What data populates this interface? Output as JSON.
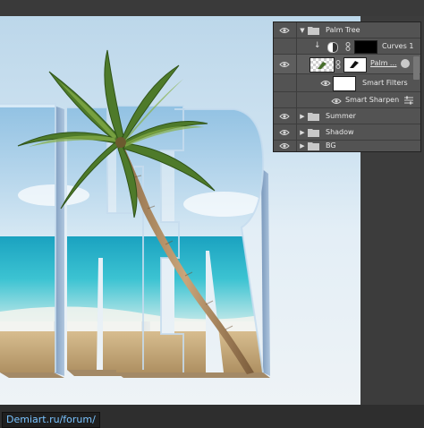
{
  "layers_panel": {
    "rows": [
      {
        "name": "Palm Tree",
        "kind": "group-open"
      },
      {
        "name": "Curves 1",
        "kind": "adjustment"
      },
      {
        "name": "Palm ...",
        "kind": "smart-object"
      },
      {
        "name": "Smart Filters",
        "kind": "smart-filters"
      },
      {
        "name": "Smart Sharpen",
        "kind": "filter"
      },
      {
        "name": "Summer",
        "kind": "group"
      },
      {
        "name": "Shadow",
        "kind": "group"
      },
      {
        "name": "BG",
        "kind": "group"
      }
    ]
  },
  "footer": {
    "watermark": "Demiart.ru/forum/"
  },
  "colors": {
    "panel_bg": "#535353",
    "row_selected": "#5e5e5e",
    "watermark_text": "#79c3ff",
    "sea": "#2bb0c8",
    "sand": "#c8a97a"
  },
  "icons": [
    "eye-icon",
    "folder-icon",
    "chevron-down-icon",
    "chevron-right-icon",
    "curves-adjustment-icon",
    "link-icon",
    "smart-filter-icon",
    "filter-options-icon"
  ]
}
